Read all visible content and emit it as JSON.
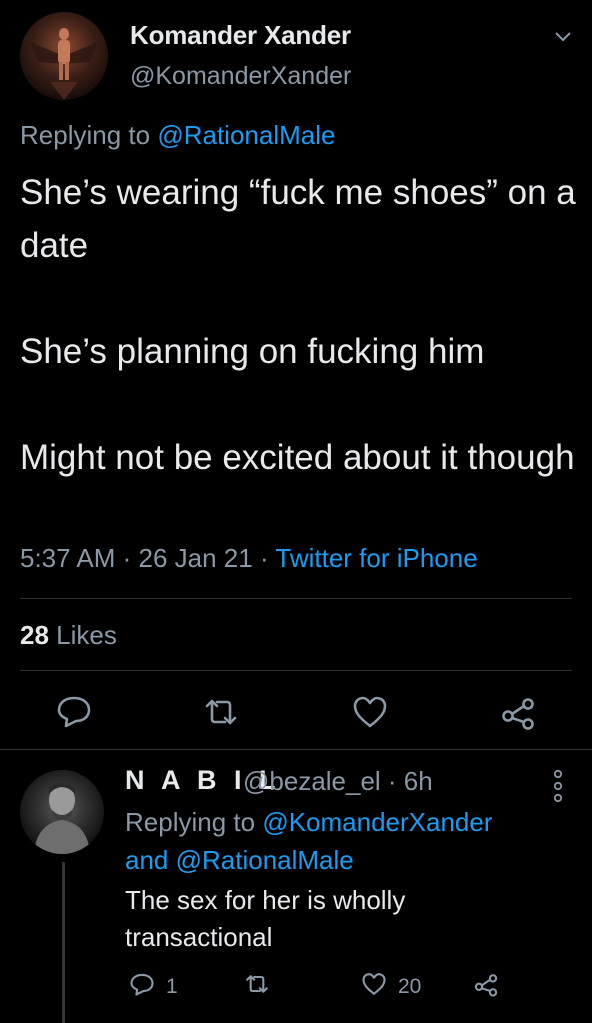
{
  "tweet": {
    "display_name": "Komander Xander",
    "handle": "@KomanderXander",
    "replying_prefix": "Replying to ",
    "replying_to": "@RationalMale",
    "text": "She’s wearing “fuck me shoes” on a date\n\nShe’s planning on fucking him\n\nMight not be excited about it though",
    "time": "5:37 AM",
    "date": "26 Jan 21",
    "separator": " · ",
    "source": "Twitter for iPhone",
    "likes_count": "28",
    "likes_label": " Likes"
  },
  "reply": {
    "display_name": "N A B I L",
    "handle_time": "@bezale_el · 6h",
    "replying_prefix": "Replying to ",
    "replying_to_1": "@KomanderXander",
    "and": "and ",
    "replying_to_2": "@RationalMale",
    "text": "The sex for her is wholly transactional",
    "reply_count": "1",
    "like_count": "20"
  },
  "colors": {
    "background": "#000000",
    "text": "#e7e9ea",
    "muted": "#8b98a5",
    "link": "#1d9bf0",
    "divider": "#2f3336"
  },
  "icons": [
    "chevron-down-icon",
    "reply-icon",
    "retweet-icon",
    "heart-icon",
    "share-icon",
    "more-vertical-icon"
  ]
}
